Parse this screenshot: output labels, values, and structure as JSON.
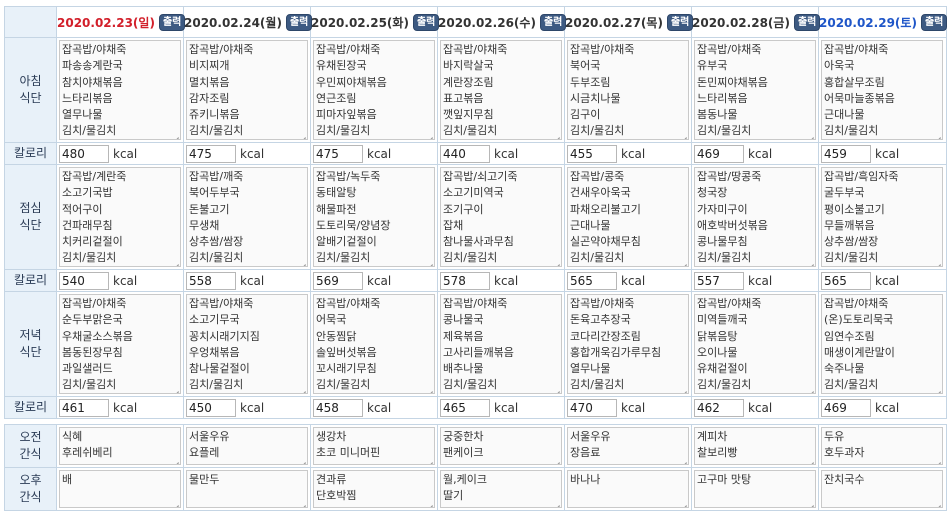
{
  "unit": "kcal",
  "print_label": "출력",
  "row_labels": {
    "breakfast": "아침\n식단",
    "lunch": "점심\n식단",
    "dinner": "저녁\n식단",
    "calorie": "칼로리",
    "am_snack": "오전\n간식",
    "pm_snack": "오후\n간식"
  },
  "days": [
    {
      "date": "2020.02.23(일)",
      "breakfast": "잡곡밥/야채죽\n파송송계란국\n참치야채볶음\n느타리볶음\n열무나물\n김치/물김치",
      "breakfast_kcal": "480",
      "lunch": "잡곡밥/계란죽\n소고기국밥\n적어구이\n건파래무침\n치커리겉절이\n김치/물김치",
      "lunch_kcal": "540",
      "dinner": "잡곡밥/야채죽\n순두부맑은국\n우채굴소스볶음\n봄동된장무침\n과일샐러드\n김치/물김치",
      "dinner_kcal": "461",
      "am_snack": "식혜\n후레쉬베리",
      "pm_snack": "배"
    },
    {
      "date": "2020.02.24(월)",
      "breakfast": "잡곡밥/야채죽\n비지찌개\n멸치볶음\n감자조림\n쥬키니볶음\n김치/물김치",
      "breakfast_kcal": "475",
      "lunch": "잡곡밥/깨죽\n북어두부국\n돈불고기\n무생채\n상추쌈/쌈장\n김치/물김치",
      "lunch_kcal": "558",
      "dinner": "잡곡밥/야채죽\n소고기무국\n꽁치시래기지짐\n우엉채볶음\n참나물겉절이\n김치/물김치",
      "dinner_kcal": "450",
      "am_snack": "서울우유\n요플레",
      "pm_snack": "물만두"
    },
    {
      "date": "2020.02.25(화)",
      "breakfast": "잡곡밥/야채죽\n유채된장국\n우민찌야채볶음\n연근조림\n피마자잎볶음\n김치/물김치",
      "breakfast_kcal": "475",
      "lunch": "잡곡밥/녹두죽\n동태알탕\n해물파전\n도토리묵/양념장\n알배기겉절이\n김치/물김치",
      "lunch_kcal": "569",
      "dinner": "잡곡밥/야채죽\n어묵국\n안동찜닭\n솔잎버섯볶음\n꼬시래기무침\n김치/물김치",
      "dinner_kcal": "458",
      "am_snack": "생강차\n초코 미니머핀",
      "pm_snack": "견과류\n단호박찜"
    },
    {
      "date": "2020.02.26(수)",
      "breakfast": "잡곡밥/야채죽\n바지락살국\n계란장조림\n표고볶음\n깻잎지무침\n김치/물김치",
      "breakfast_kcal": "440",
      "lunch": "잡곡밥/쇠고기죽\n소고기미역국\n조기구이\n잡채\n참나물사과무침\n김치/물김치",
      "lunch_kcal": "578",
      "dinner": "잡곡밥/야채죽\n콩나물국\n제육볶음\n고사리들깨볶음\n배추나물\n김치/물김치",
      "dinner_kcal": "465",
      "am_snack": "궁중한차\n팬케이크",
      "pm_snack": "월,케이크\n딸기"
    },
    {
      "date": "2020.02.27(목)",
      "breakfast": "잡곡밥/야채죽\n북어국\n두부조림\n시금치나물\n김구이\n김치/물김치",
      "breakfast_kcal": "455",
      "lunch": "잡곡밥/콩죽\n건새우아욱국\n파채오리불고기\n근대나물\n실곤약야채무침\n김치/물김치",
      "lunch_kcal": "565",
      "dinner": "잡곡밥/야채죽\n돈육고추장국\n코다리간장조림\n홍합개욱김가루무침\n열무나물\n김치/물김치",
      "dinner_kcal": "470",
      "am_snack": "서울우유\n장음료",
      "pm_snack": "바나나"
    },
    {
      "date": "2020.02.28(금)",
      "breakfast": "잡곡밥/야채죽\n유부국\n돈민찌야채볶음\n느타리볶음\n봄동나물\n김치/물김치",
      "breakfast_kcal": "469",
      "lunch": "잡곡밥/땅콩죽\n청국장\n가자미구이\n애호박버섯볶음\n콩나물무침\n김치/물김치",
      "lunch_kcal": "557",
      "dinner": "잡곡밥/야채죽\n미역들깨국\n닭볶음탕\n오이나물\n유채겉절이\n김치/물김치",
      "dinner_kcal": "462",
      "am_snack": "계피차\n찰보리빵",
      "pm_snack": "고구마 맛탕"
    },
    {
      "date": "2020.02.29(토)",
      "breakfast": "잡곡밥/야채죽\n아욱국\n홍합살무조림\n어묵마늘종볶음\n근대나물\n김치/물김치",
      "breakfast_kcal": "459",
      "lunch": "잡곡밥/흑임자죽\n굴두부국\n평이소불고기\n무들깨볶음\n상추쌈/쌈장\n김치/물김치",
      "lunch_kcal": "565",
      "dinner": "잡곡밥/야채죽\n(온)도토리묵국\n임연수조림\n매생이계란말이\n숙주나물\n김치/물김치",
      "dinner_kcal": "469",
      "am_snack": "두유\n호두과자",
      "pm_snack": "잔치국수"
    }
  ]
}
